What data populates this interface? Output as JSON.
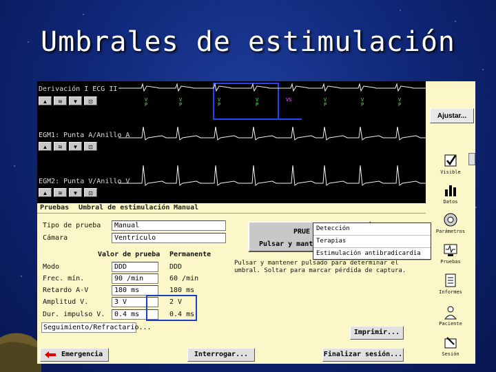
{
  "slide": {
    "title": "Umbrales de estimulación"
  },
  "ecg": {
    "channels": [
      {
        "label": "Derivación I ECG II"
      },
      {
        "label": "EGM1: Punta A/Anillo A"
      },
      {
        "label": "EGM2: Punta V/Anillo V"
      }
    ],
    "control_icons": [
      "arrow-up-icon",
      "scale-icon",
      "arrow-down-icon",
      "freeze-icon"
    ],
    "marker_top": "V",
    "marker_bottom": "P",
    "pink_marker": "VS"
  },
  "sidebar": {
    "adjust_button": "Ajustar...",
    "tools": [
      {
        "label": "Visible",
        "icon": "checkbox-icon"
      },
      {
        "label": "Datos",
        "icon": "bar-chart-icon"
      },
      {
        "label": "Parámetros",
        "icon": "parameters-icon"
      },
      {
        "label": "Pruebas",
        "icon": "monitor-icon"
      },
      {
        "label": "Informes",
        "icon": "report-icon"
      },
      {
        "label": "Paciente",
        "icon": "patient-icon"
      },
      {
        "label": "Sesión",
        "icon": "session-icon"
      }
    ]
  },
  "menu": {
    "items": [
      "Pruebas",
      "Umbral de estimulación",
      "Manual"
    ]
  },
  "form": {
    "test_type_label": "Tipo de prueba",
    "test_type_value": "Manual",
    "chamber_label": "Cámara",
    "chamber_value": "Ventrículo",
    "col_test": "Valor de prueba",
    "col_perm": "Permanente",
    "rows": [
      {
        "label": "Modo",
        "test": "DDD",
        "perm": "DDD"
      },
      {
        "label": "Frec. mín.",
        "test": "90 /min",
        "perm": "60 /min"
      },
      {
        "label": "Retardo A-V",
        "test": "180 ms",
        "perm": "180 ms"
      },
      {
        "label": "Amplitud V.",
        "test": "3 V",
        "perm": "2 V"
      },
      {
        "label": "Dur. impulso V.",
        "test": "0.4 ms",
        "perm": "0.4 ms"
      }
    ],
    "follow_button": "Seguimiento/Refractario..."
  },
  "test_button": {
    "line1": "PRUE",
    "line2": "Pulsar y mant"
  },
  "dropdown": {
    "items": [
      "Detección",
      "Terapias",
      "Estimulación antibradicardia"
    ]
  },
  "instructions": "Pulsar y mantener pulsado para determinar el umbral. Soltar para marcar pérdida de captura.",
  "buttons": {
    "print": "Imprimir...",
    "emergency": "Emergencia",
    "interrogate": "Interrogar...",
    "end_session": "Finalizar sesión..."
  }
}
